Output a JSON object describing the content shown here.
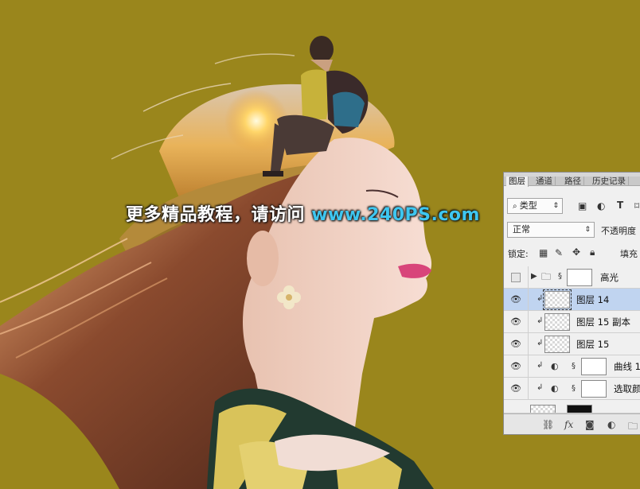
{
  "watermark": {
    "text": "更多精品教程，请访问",
    "url": "www.240PS.com"
  },
  "layers_panel": {
    "tabs": [
      "图层",
      "通道",
      "路径",
      "历史记录"
    ],
    "active_tab": "图层",
    "filter": {
      "icon": "search-icon",
      "value": "类型"
    },
    "blend_mode": "正常",
    "opacity_label": "不透明度",
    "lock_label": "锁定:",
    "fill_label": "填充",
    "layers": [
      {
        "name": "高光",
        "type": "group",
        "visible": false,
        "selected": false
      },
      {
        "name": "图层 14",
        "type": "pixel",
        "visible": true,
        "selected": true,
        "clipped": true
      },
      {
        "name": "图层 15 副本",
        "type": "pixel",
        "visible": true,
        "selected": false,
        "clipped": true
      },
      {
        "name": "图层 15",
        "type": "pixel",
        "visible": true,
        "selected": false,
        "clipped": true
      },
      {
        "name": "曲线 1",
        "type": "adjustment",
        "visible": true,
        "selected": false,
        "clipped": true
      },
      {
        "name": "选取颜",
        "type": "adjustment",
        "visible": true,
        "selected": false,
        "clipped": true
      }
    ],
    "footer_icons": [
      "link-icon",
      "fx-icon",
      "mask-icon",
      "adjustment-icon",
      "folder-icon"
    ],
    "footer_fx": "fx"
  },
  "colors": {
    "background": "#9a861c",
    "watermark_url": "#3ec6f0",
    "selected_layer": "#c0d4f0"
  }
}
